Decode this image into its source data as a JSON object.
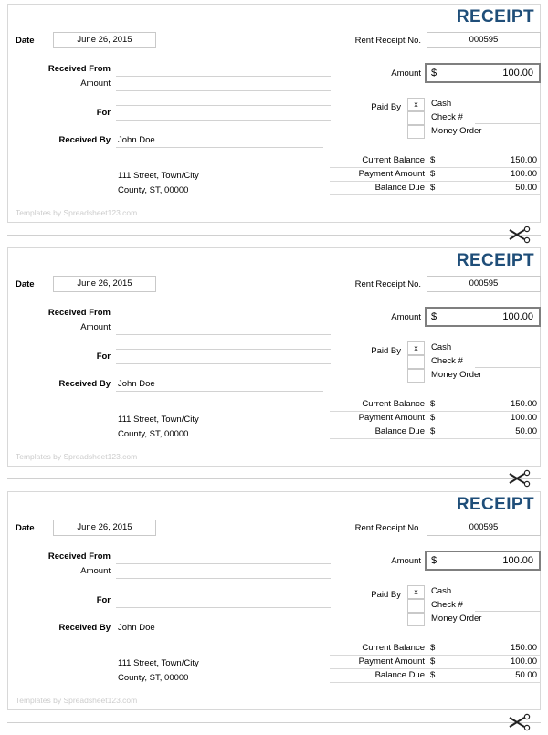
{
  "document": {
    "title": "Rent Receipt Template",
    "accent_color": "#1f4e79",
    "card_border_color": "#d8d8d8",
    "amount_box_border_color": "#7f7f7f",
    "footer_text_color": "#cccccc"
  },
  "receipt": {
    "title": "RECEIPT",
    "date_label": "Date",
    "date_value": "June 26, 2015",
    "receipt_no_label": "Rent Receipt No.",
    "receipt_no_value": "000595",
    "fields": [
      {
        "label": "Received From",
        "bold": true,
        "value": ""
      },
      {
        "label": "Amount",
        "bold": false,
        "value": ""
      },
      {
        "label": "",
        "bold": false,
        "value": ""
      },
      {
        "label": "For",
        "bold": true,
        "value": ""
      },
      {
        "label": "Received By",
        "bold": true,
        "value": "John Doe"
      }
    ],
    "address_line1": "111 Street, Town/City",
    "address_line2": "County, ST, 00000",
    "amount_label": "Amount",
    "amount_currency": "$",
    "amount_value": "100.00",
    "paid_by_label": "Paid By",
    "paid_options": [
      {
        "label": "Cash",
        "checked": "x"
      },
      {
        "label": "Check #",
        "checked": ""
      },
      {
        "label": "Money Order",
        "checked": ""
      }
    ],
    "balance_rows": [
      {
        "label": "Current Balance",
        "currency": "$",
        "value": "150.00"
      },
      {
        "label": "Payment Amount",
        "currency": "$",
        "value": "100.00"
      },
      {
        "label": "Balance Due",
        "currency": "$",
        "value": "50.00"
      }
    ],
    "footer": "Templates by Spreadsheet123.com"
  },
  "cut_line": {
    "icon": "scissors-icon"
  },
  "copies": [
    1,
    2,
    3
  ]
}
